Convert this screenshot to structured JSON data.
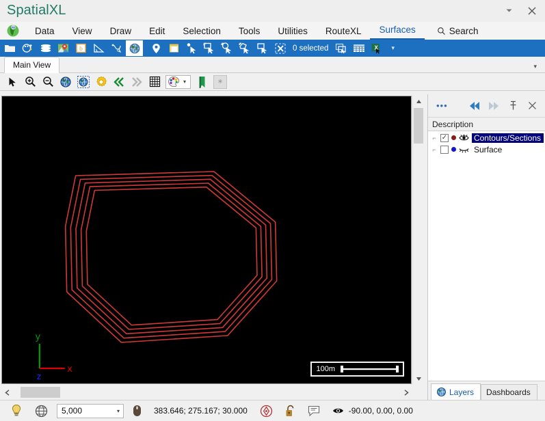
{
  "window": {
    "title": "SpatialXL",
    "minimize_label": "▾",
    "close_label": "✕"
  },
  "menu": {
    "logo_icon": "africa-globe-icon",
    "items": [
      {
        "label": "Data",
        "active": false
      },
      {
        "label": "View",
        "active": false
      },
      {
        "label": "Draw",
        "active": false
      },
      {
        "label": "Edit",
        "active": false
      },
      {
        "label": "Selection",
        "active": false
      },
      {
        "label": "Tools",
        "active": false
      },
      {
        "label": "Utilities",
        "active": false
      },
      {
        "label": "RouteXL",
        "active": false
      },
      {
        "label": "Surfaces",
        "active": true
      }
    ],
    "search_label": "Search",
    "search_icon": "search-icon",
    "active_color": "#1b5fa8"
  },
  "ribbon": {
    "background": "#1d6fc0",
    "icons": [
      "open-folder-icon",
      "palette-settings-icon",
      "layers-stack-icon",
      "map-pin-image-icon",
      "bing-map-icon",
      "angle-measure-icon",
      "polyline-edit-icon",
      "globe-icon",
      "location-pin-icon",
      "window-snapshot-icon",
      "select-point-icon",
      "select-rectangle-icon",
      "select-circle-icon",
      "select-polygon-icon",
      "select-box-icon",
      "clear-selection-icon"
    ],
    "selection_label": "0 selected",
    "after_icons": [
      "copy-window-icon",
      "table-icon",
      "excel-export-icon"
    ],
    "overflow_caret": "▾"
  },
  "tabstrip": {
    "tabs": [
      {
        "label": "Main View",
        "active": true
      }
    ],
    "overflow_caret": "▾"
  },
  "viewbar": {
    "icons": [
      "arrow-select-icon",
      "zoom-in-icon",
      "zoom-out-icon",
      "globe-zoom-extents-icon",
      "globe-zoom-selected-icon",
      "gear-settings-icon",
      "rewind-icon",
      "fast-forward-icon",
      "grid-icon"
    ],
    "color_combo_icon": "color-palette-icon",
    "color_combo_caret": "▾",
    "bookmark_icon": "green-bookmark-icon",
    "extra_box_label": "∗"
  },
  "canvas": {
    "background": "#000000",
    "contour_color": "#cf3a38",
    "contour_count": 5,
    "axis": {
      "x_label": "x",
      "x_color": "#e00000",
      "y_label": "y",
      "y_color": "#00a000",
      "z_label": "z",
      "z_color": "#2020ff"
    },
    "scalebar": {
      "label": "100m"
    }
  },
  "dock": {
    "menu_icon": "more-options-icon",
    "back_icon": "collapse-left-icon",
    "forward_icon": "collapse-right-icon",
    "pin_icon": "pin-icon",
    "close_icon": "close-icon",
    "column_header": "Description",
    "layers": [
      {
        "name": "Contours/Sections",
        "checked": true,
        "selected": true,
        "dot_color": "#8b1a1a",
        "visibility_icon": "eye-open-icon"
      },
      {
        "name": "Surface",
        "checked": false,
        "selected": false,
        "dot_color": "#1515cc",
        "visibility_icon": "eye-closed-icon"
      }
    ],
    "tabs": [
      {
        "label": "Layers",
        "active": true,
        "icon": "globe-icon"
      },
      {
        "label": "Dashboards",
        "active": false,
        "icon": ""
      }
    ]
  },
  "statusbar": {
    "hint_icon": "lightbulb-icon",
    "projection_icon": "wireframe-globe-icon",
    "scale_value": "5,000",
    "scale_caret": "▾",
    "mouse_icon": "mouse-icon",
    "coordinates": "383.646; 275.167; 30.000",
    "snap_icon": "snap-target-icon",
    "lock_icon": "unlocked-padlock-icon",
    "note_icon": "comment-icon",
    "view_icon": "eye-icon",
    "view_angles": "-90.00, 0.00, 0.00"
  }
}
